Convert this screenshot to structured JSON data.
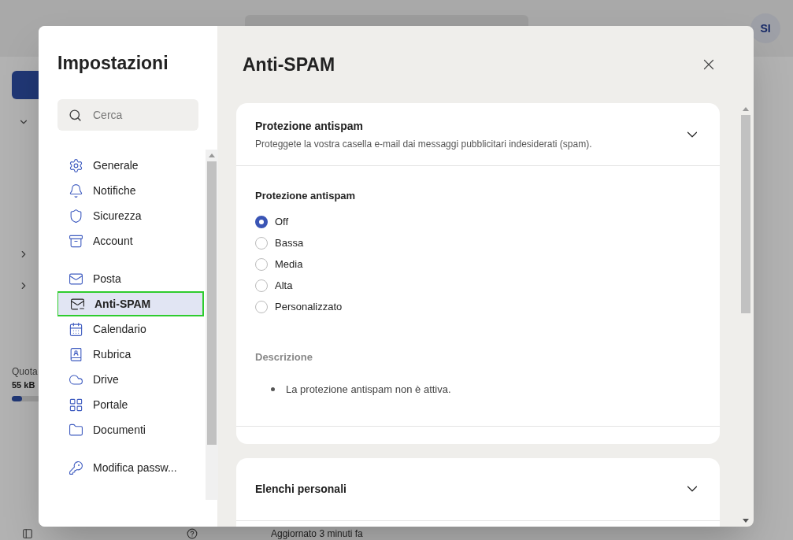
{
  "header": {
    "avatar": "SI"
  },
  "background": {
    "quota_label": "Quota",
    "quota_value": "55 kB",
    "quota_bar": {
      "level": 0.07
    },
    "status": "Aggiornato 3 minuti fa"
  },
  "settings": {
    "title": "Impostazioni",
    "search": {
      "placeholder": "Cerca"
    },
    "nav_groups": [
      [
        {
          "label": "Generale",
          "kind": "gear",
          "selected": false
        },
        {
          "label": "Notifiche",
          "kind": "bell",
          "selected": false
        },
        {
          "label": "Sicurezza",
          "kind": "shield",
          "selected": false
        },
        {
          "label": "Account",
          "kind": "stack",
          "selected": false
        }
      ],
      [
        {
          "label": "Posta",
          "kind": "mail",
          "selected": false
        },
        {
          "label": "Anti-SPAM",
          "kind": "mail-block",
          "selected": true
        },
        {
          "label": "Calendario",
          "kind": "calendar",
          "selected": false
        },
        {
          "label": "Rubrica",
          "kind": "contacts",
          "selected": false
        },
        {
          "label": "Drive",
          "kind": "cloud",
          "selected": false
        },
        {
          "label": "Portale",
          "kind": "grid",
          "selected": false
        },
        {
          "label": "Documenti",
          "kind": "folder",
          "selected": false
        }
      ],
      [
        {
          "label": "Modifica passw...",
          "kind": "key",
          "selected": false
        }
      ]
    ]
  },
  "panel": {
    "title": "Anti-SPAM",
    "sections": [
      {
        "title": "Protezione antispam",
        "subtitle": "Proteggete la vostra casella e-mail dai messaggi pubblicitari indesiderati (spam).",
        "expanded": true,
        "field_label": "Protezione antispam",
        "options": [
          {
            "label": "Off",
            "selected": true
          },
          {
            "label": "Bassa",
            "selected": false
          },
          {
            "label": "Media",
            "selected": false
          },
          {
            "label": "Alta",
            "selected": false
          },
          {
            "label": "Personalizzato",
            "selected": false
          }
        ],
        "description_label": "Descrizione",
        "description_items": [
          "La protezione antispam non è attiva."
        ]
      },
      {
        "title": "Elenchi personali",
        "expanded": false
      }
    ]
  }
}
